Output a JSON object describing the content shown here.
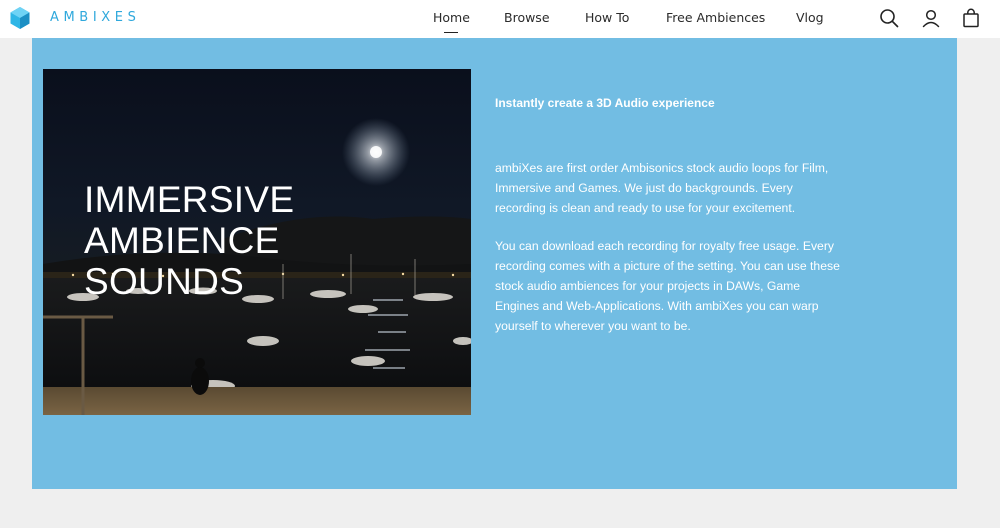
{
  "brand": {
    "name": "AMBIXES",
    "color": "#2fa8dc"
  },
  "nav": {
    "items": [
      {
        "label": "Home",
        "active": true
      },
      {
        "label": "Browse"
      },
      {
        "label": "How To"
      },
      {
        "label": "Free Ambiences"
      },
      {
        "label": "Vlog"
      }
    ]
  },
  "header_icons": [
    "search-icon",
    "account-icon",
    "shopping-bag-icon"
  ],
  "hero": {
    "background": "#72bde3",
    "title_lines": [
      "IMMERSIVE",
      "AMBIENCE",
      "SOUNDS"
    ],
    "tagline": "Instantly create a 3D Audio experience",
    "paragraph1": "ambiXes are first order Ambisonics stock audio loops for Film, Immersive and Games. We just do backgrounds. Every recording is clean and ready to use for your excitement.",
    "paragraph2": "You can download each recording for royalty free usage. Every recording comes with a picture of the setting. You can use these stock audio ambiences for your projects in DAWs, Game Engines and Web-Applications. With ambiXes you can warp yourself to wherever you want to be."
  }
}
